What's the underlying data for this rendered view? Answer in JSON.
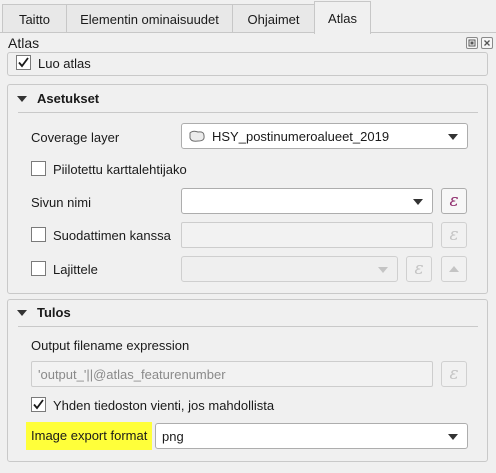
{
  "tabs": [
    {
      "label": "Taitto",
      "active": false
    },
    {
      "label": "Elementin ominaisuudet",
      "active": false
    },
    {
      "label": "Ohjaimet",
      "active": false
    },
    {
      "label": "Atlas",
      "active": true
    }
  ],
  "panel": {
    "title": "Atlas",
    "generate_label": "Luo atlas",
    "generate_checked": true
  },
  "settings": {
    "title": "Asetukset",
    "coverage_label": "Coverage layer",
    "coverage_value": "HSY_postinumeroalueet_2019",
    "hidden_label": "Piilotettu karttalehtijako",
    "hidden_checked": false,
    "page_name_label": "Sivun nimi",
    "page_name_value": "",
    "filter_label": "Suodattimen kanssa",
    "filter_checked": false,
    "sort_label": "Lajittele",
    "sort_checked": false
  },
  "output": {
    "title": "Tulos",
    "filename_label": "Output filename expression",
    "filename_value": "'output_'||@atlas_featurenumber",
    "single_file_label": "Yhden tiedoston vienti, jos mahdollista",
    "single_file_checked": true,
    "format_label": "Image export format",
    "format_value": "png",
    "highlight_color": "#ffff3a"
  },
  "icons": {
    "expression": "ε",
    "float": "float-icon",
    "close": "close-icon"
  }
}
